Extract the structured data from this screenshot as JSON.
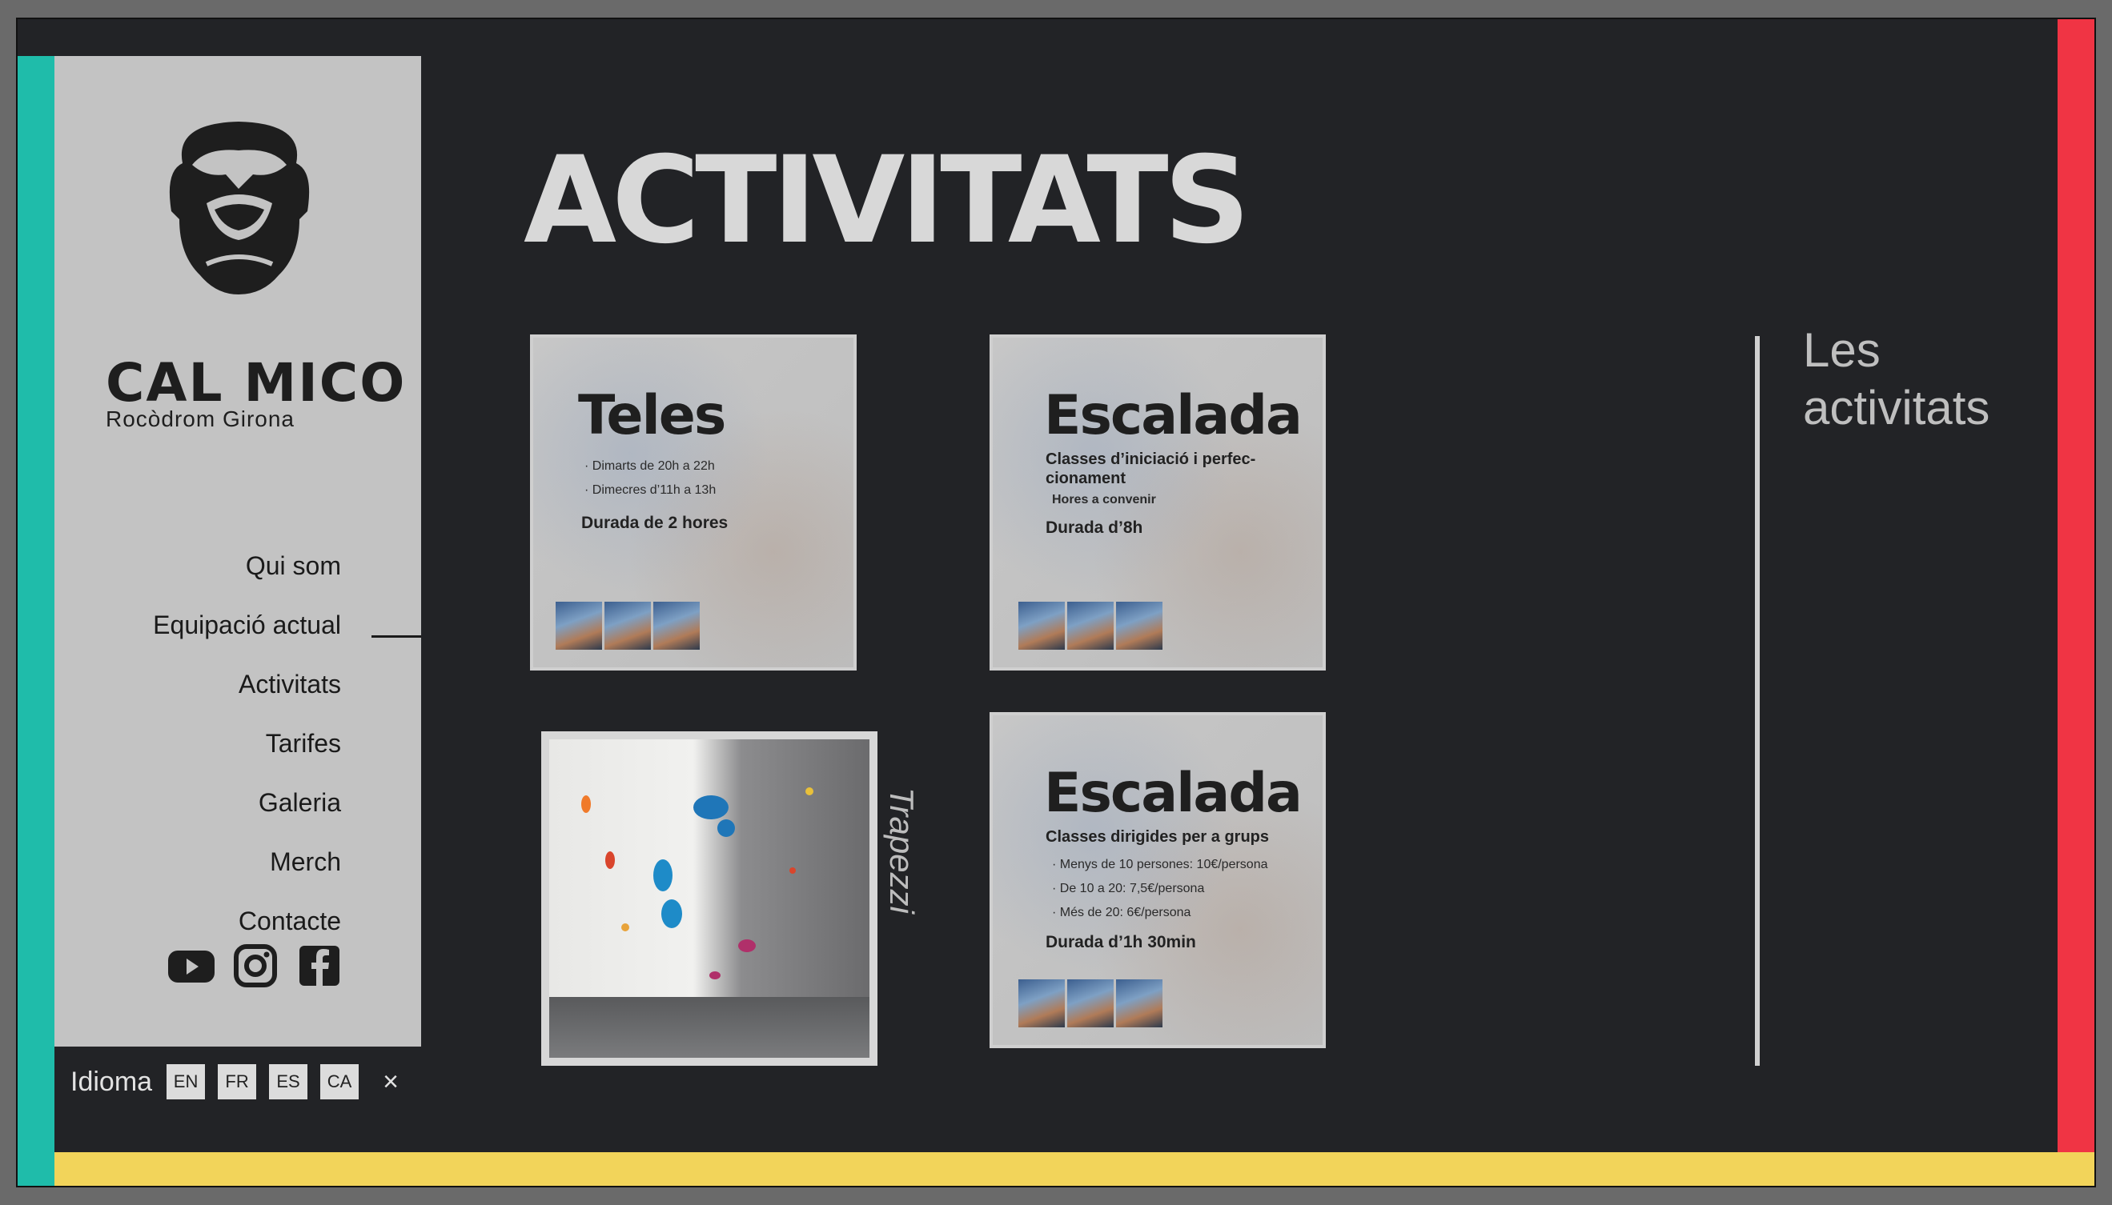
{
  "brand": {
    "name": "CAL MICO",
    "subtitle": "Rocòdrom Girona"
  },
  "nav": {
    "items": [
      {
        "label": "Qui som"
      },
      {
        "label": "Equipació actual"
      },
      {
        "label": "Activitats",
        "active": true
      },
      {
        "label": "Tarifes"
      },
      {
        "label": "Galeria"
      },
      {
        "label": "Merch"
      },
      {
        "label": "Contacte"
      }
    ]
  },
  "social": {
    "icons": [
      "youtube-icon",
      "instagram-icon",
      "facebook-icon"
    ]
  },
  "language": {
    "label": "Idioma",
    "options": [
      "EN",
      "FR",
      "ES",
      "CA"
    ],
    "close": "×"
  },
  "page": {
    "title": "ACTIVITATS"
  },
  "cards": {
    "teles": {
      "title": "Teles",
      "lines": [
        "· Dimarts de 20h a 22h",
        "· Dimecres d’11h a 13h"
      ],
      "duration": "Durada de 2 hores"
    },
    "escalada1": {
      "title": "Escalada",
      "subtitle": "Classes d’iniciació i perfec- cionament",
      "note": "Hores a convenir",
      "duration": "Durada d’8h"
    },
    "trapezzi": {
      "label": "Trapezzi"
    },
    "escalada2": {
      "title": "Escalada",
      "subtitle": "Classes dirigides per a grups",
      "lines": [
        "· Menys de 10 persones: 10€/persona",
        "· De 10 a 20: 7,5€/persona",
        "· Més de 20: 6€/persona"
      ],
      "duration": "Durada d’1h 30min"
    }
  },
  "aside": {
    "heading": "Les activitats"
  },
  "colors": {
    "teal": "#1fbcaa",
    "red": "#f03444",
    "yellow": "#f2d45a",
    "background": "#222326",
    "sidebar": "#c3c3c3"
  }
}
